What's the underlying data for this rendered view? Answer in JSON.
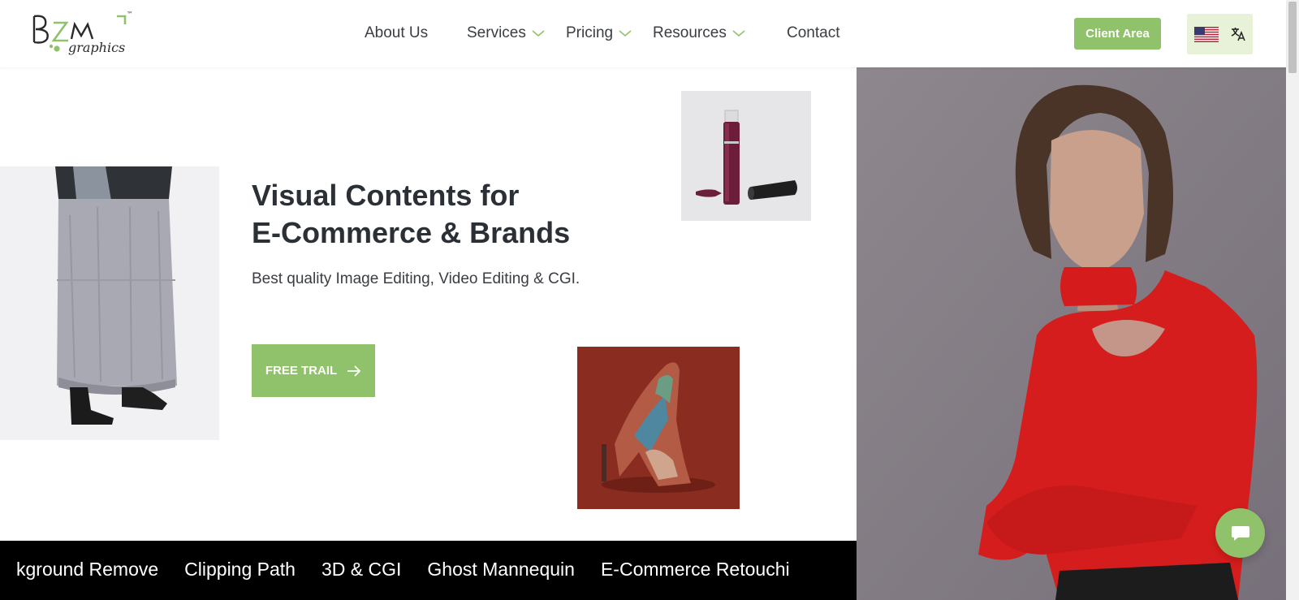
{
  "header": {
    "logo": {
      "main": "BZM",
      "sub": "graphics",
      "tm": "™",
      "icon": "bzm-logo-icon"
    },
    "nav": {
      "about": "About Us",
      "services": "Services",
      "pricing": "Pricing",
      "resources": "Resources",
      "contact": "Contact"
    },
    "client_area": "Client Area",
    "language": {
      "flag_icon": "us-flag-icon",
      "translate_icon": "translate-icon"
    }
  },
  "hero": {
    "title_line1": "Visual Contents for",
    "title_line2": "E-Commerce & Brands",
    "subtitle": "Best quality Image Editing, Video Editing & CGI.",
    "cta_label": "FREE TRAIL",
    "cta_icon": "arrow-right-icon"
  },
  "ticker": {
    "items": [
      "kground Remove",
      "Clipping Path",
      "3D & CGI",
      "Ghost Mannequin",
      "E-Commerce Retouchi"
    ]
  },
  "chat": {
    "icon": "chat-bubble-icon"
  },
  "colors": {
    "accent": "#8fc26a",
    "accent_light": "#e8f2d8",
    "text_dark": "#2b2f36",
    "ticker_bg": "#000000"
  }
}
